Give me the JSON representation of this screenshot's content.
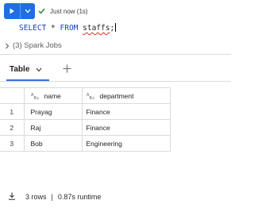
{
  "status": {
    "text": "Just now (1s)"
  },
  "code": {
    "kw1": "SELECT",
    "star": " * ",
    "kw2": "FROM",
    "table": "staffs",
    "end": ";"
  },
  "spark_jobs": {
    "label": "(3) Spark Jobs"
  },
  "tabs": [
    {
      "label": "Table"
    }
  ],
  "table": {
    "columns": [
      {
        "type_icon": "abc-type-icon",
        "label": "name"
      },
      {
        "type_icon": "abc-type-icon",
        "label": "department"
      }
    ],
    "rows": [
      {
        "n": "1",
        "name": "Prayag",
        "department": "Finance"
      },
      {
        "n": "2",
        "name": "Raj",
        "department": "Finance"
      },
      {
        "n": "3",
        "name": "Bob",
        "department": "Engineering"
      }
    ]
  },
  "footer": {
    "rows": "3 rows",
    "separator": "|",
    "runtime": "0.87s runtime"
  },
  "colors": {
    "accent": "#1f6fe0",
    "success": "#2e7d32",
    "keyword": "#1a3fc7",
    "error_underline": "#d93025"
  }
}
